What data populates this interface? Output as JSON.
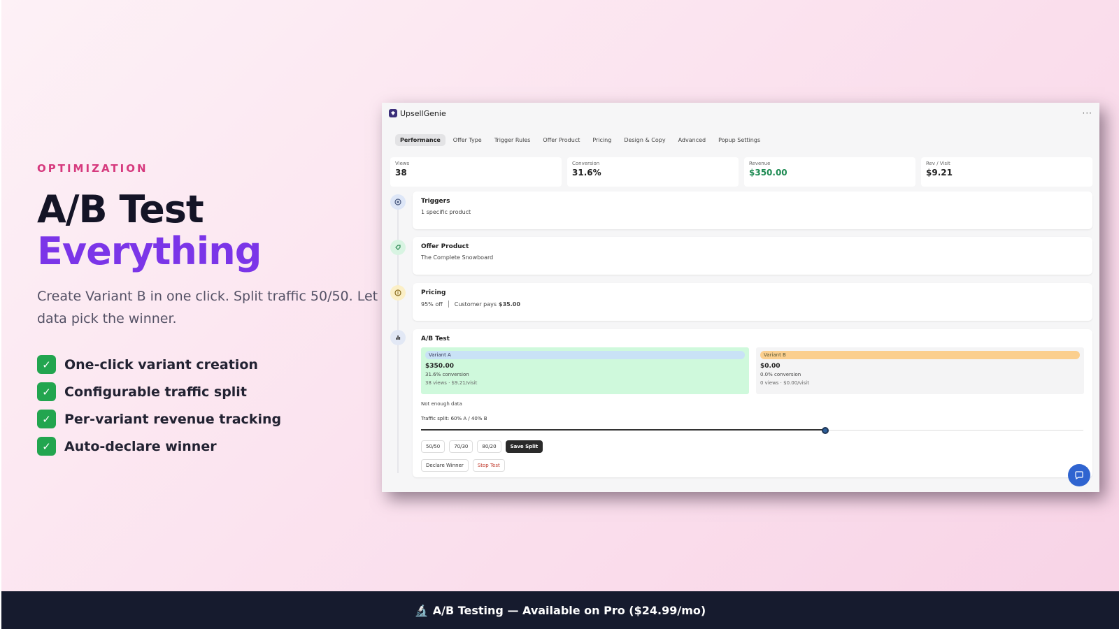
{
  "hero": {
    "eyebrow": "OPTIMIZATION",
    "title_line1": "A/B Test",
    "title_line2": "Everything",
    "subtitle": "Create Variant B in one click. Split traffic 50/50. Let data pick the winner.",
    "features": [
      "One-click variant creation",
      "Configurable traffic split",
      "Per-variant revenue tracking",
      "Auto-declare winner"
    ],
    "check_glyph": "✓"
  },
  "app": {
    "name": "UpsellGenie",
    "menu_glyph": "···",
    "tabs": [
      "Performance",
      "Offer Type",
      "Trigger Rules",
      "Offer Product",
      "Pricing",
      "Design & Copy",
      "Advanced",
      "Popup Settings"
    ],
    "active_tab": "Performance",
    "metrics": [
      {
        "label": "Views",
        "value": "38"
      },
      {
        "label": "Conversion",
        "value": "31.6%"
      },
      {
        "label": "Revenue",
        "value": "$350.00"
      },
      {
        "label": "Rev / Visit",
        "value": "$9.21"
      }
    ],
    "triggers": {
      "title": "Triggers",
      "subtitle": "1 specific product",
      "icon": "target-icon"
    },
    "offer_product": {
      "title": "Offer Product",
      "subtitle": "The Complete Snowboard",
      "icon": "tag-icon"
    },
    "pricing": {
      "title": "Pricing",
      "discount": "95% off",
      "customer_pays_label": "Customer pays",
      "customer_pays_value": "$35.00",
      "icon": "dollar-icon"
    },
    "ab_test": {
      "title": "A/B Test",
      "icon": "bar-chart-icon",
      "variant_a": {
        "label": "Variant A",
        "revenue": "$350.00",
        "conversion": "31.6% conversion",
        "meta": "38 views · $9.21/visit"
      },
      "variant_b": {
        "label": "Variant B",
        "revenue": "$0.00",
        "conversion": "0.0% conversion",
        "meta": "0 views · $0.00/visit"
      },
      "status": "Not enough data",
      "split_label": "Traffic split: 60% A / 40% B",
      "split_fraction_a": 0.61,
      "presets": [
        "50/50",
        "70/30",
        "80/20"
      ],
      "save_label": "Save Split",
      "declare_label": "Declare Winner",
      "stop_label": "Stop Test"
    },
    "chat_icon": "chat-icon"
  },
  "colors": {
    "accent_purple": "#7b35e8",
    "eyebrow_pink": "#d63a7e",
    "check_green": "#22a54f",
    "revenue_green": "#1d8a52",
    "footer_bg": "#161b2e"
  },
  "footer": {
    "icon": "🔬",
    "text": "A/B Testing — Available on Pro ($24.99/mo)"
  }
}
